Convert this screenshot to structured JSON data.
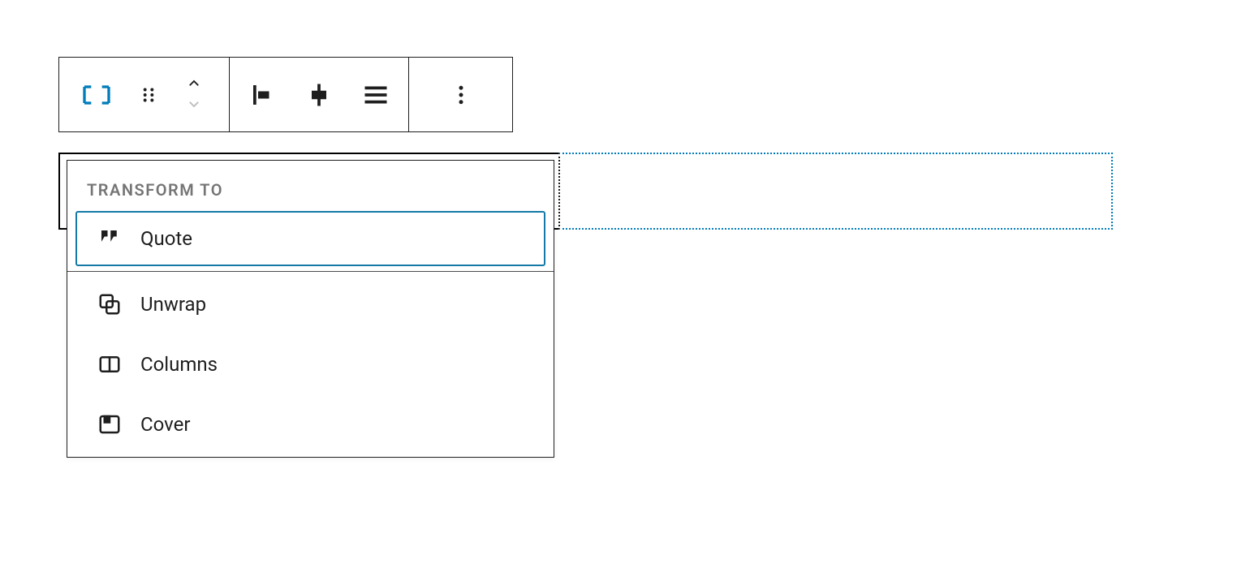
{
  "accent": "#007cba",
  "toolbar": {
    "block_type_name": "pullquote",
    "align": {
      "left": "align-left",
      "center": "align-center",
      "justify": "justify"
    },
    "more": "more-options"
  },
  "popover": {
    "heading": "Transform to",
    "items": [
      {
        "icon": "quote-icon",
        "label": "Quote",
        "selected": true
      },
      {
        "icon": "unwrap-icon",
        "label": "Unwrap",
        "selected": false
      },
      {
        "icon": "columns-icon",
        "label": "Columns",
        "selected": false
      },
      {
        "icon": "cover-icon",
        "label": "Cover",
        "selected": false
      }
    ]
  }
}
